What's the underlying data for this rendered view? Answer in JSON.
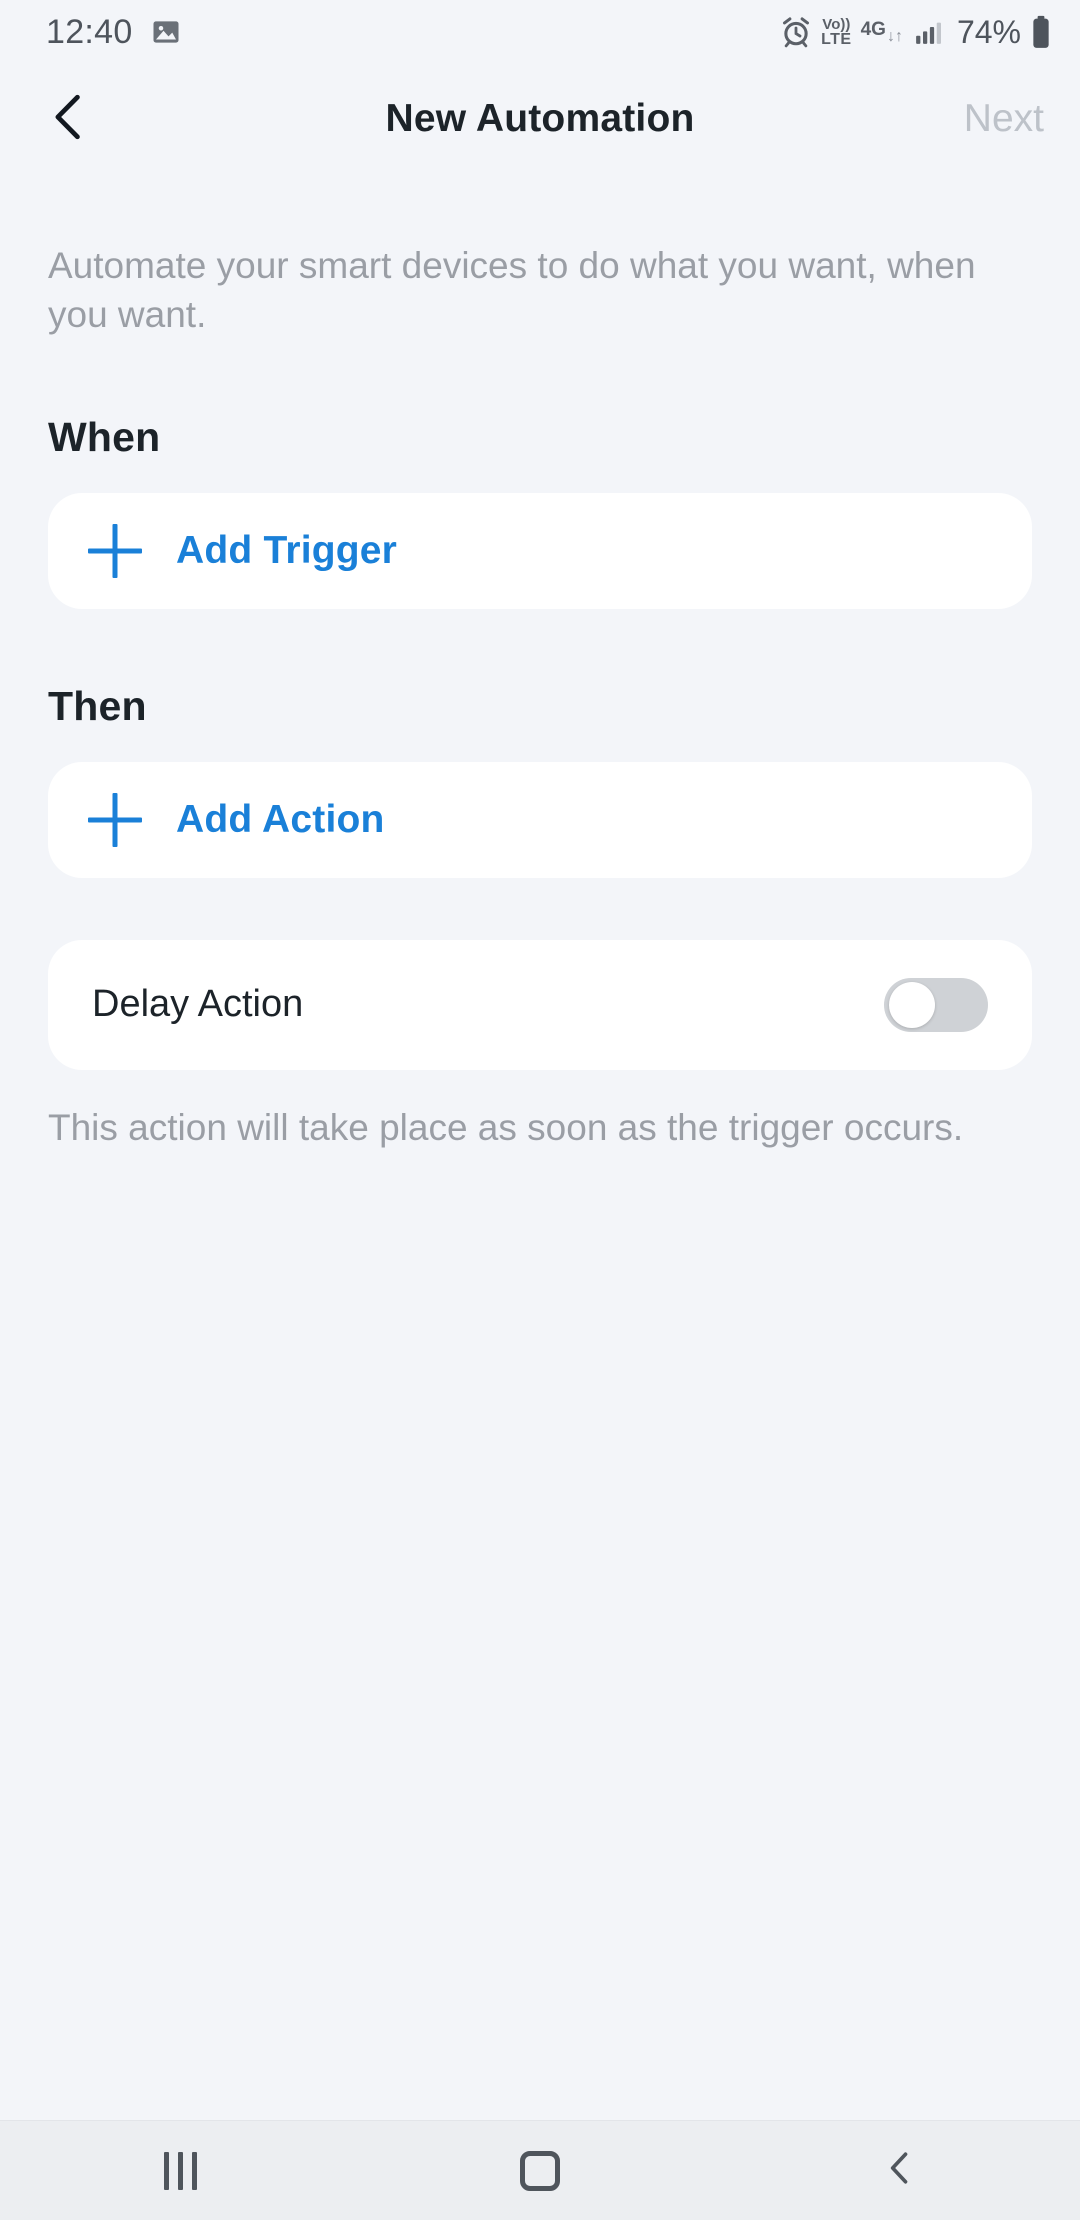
{
  "status_bar": {
    "time": "12:40",
    "image_icon": "image-icon",
    "alarm_icon": "alarm-icon",
    "volte_top": "Vo))",
    "volte_bottom": "LTE",
    "network": "4G",
    "data_arrows": "↓↑",
    "signal_icon": "signal-bars-icon",
    "battery_percent": "74%",
    "battery_icon": "battery-icon"
  },
  "app_bar": {
    "back_icon": "chevron-left-icon",
    "title": "New Automation",
    "next_label": "Next"
  },
  "main": {
    "intro_text": "Automate your smart devices to do what you want, when you want.",
    "when": {
      "heading": "When",
      "add_trigger_label": "Add Trigger",
      "plus_icon": "plus-icon"
    },
    "then": {
      "heading": "Then",
      "add_action_label": "Add Action",
      "plus_icon": "plus-icon"
    },
    "delay": {
      "label": "Delay Action",
      "toggle_state": "off",
      "hint_text": "This action will take place as soon as the trigger occurs."
    }
  },
  "nav_bar": {
    "recents_icon": "recents-icon",
    "home_icon": "home-icon",
    "back_icon": "back-chevron-icon"
  },
  "colors": {
    "accent_blue": "#1a80d8",
    "background": "#f3f5f9",
    "card": "#ffffff",
    "text_primary": "#1c2329",
    "text_muted": "#9a9ea5",
    "disabled": "#bdc2c9"
  }
}
